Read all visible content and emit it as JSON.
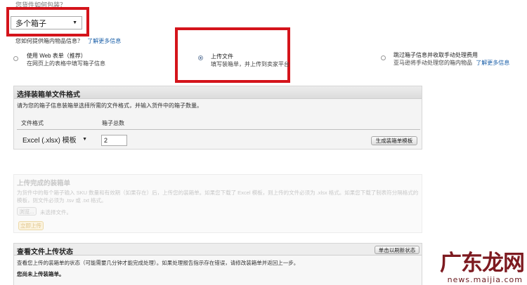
{
  "header": {
    "cut_label": "您货件如何包装？"
  },
  "packing": {
    "select_value": "多个箱子",
    "hint": "您如何提供箱内物品信息？",
    "hint_link": "了解更多信息"
  },
  "options": [
    {
      "title": "使用 Web 表单（推荐）",
      "sub": "在网页上的表格中填写箱子信息",
      "selected": false
    },
    {
      "title": "上传文件",
      "sub": "填写装箱单，并上传到卖家平台",
      "selected": true
    },
    {
      "title": "跳过箱子信息并收取手动处理费用",
      "sub": "亚马逊将手动处理您的箱内物品",
      "link": "了解更多信息",
      "selected": false
    }
  ],
  "format_panel": {
    "title": "选择装箱单文件格式",
    "desc": "请为您的箱子信息装箱单选择所需的文件格式，并输入货件中的箱子数量。",
    "col_format": "文件格式",
    "col_boxes": "箱子总数",
    "format_value": "Excel (.xlsx) 模板",
    "boxes_value": "2",
    "generate_button": "生成装箱单模板"
  },
  "upload_panel": {
    "title": "上传完成的装箱单",
    "desc": "为货件中的每个箱子输入 SKU 数量和有效期（如果存在）后，上传您的装箱单。如果您下载了 Excel 模板，则上传的文件必须为 .xlsx 格式。如果您下载了制表符分隔格式的模板，则文件必须为 .tsv 或 .txt 格式。",
    "browse_button": "浏览...",
    "no_file": "未选择文件。",
    "upload_button": "立即上传"
  },
  "status_panel": {
    "title": "查看文件上传状态",
    "refresh_button": "单击以刷新状态",
    "desc": "查看您上传的装箱单的状态（可能需要几分钟才能完成处理）。如果处理报告指示存在错误，请修改装箱单并返回上一步。",
    "empty": "您尚未上传装箱单。"
  },
  "watermark": {
    "main": "广东龙网",
    "sub": "news.maijia.com"
  },
  "colors": {
    "highlight": "#d4141b",
    "link": "#1a5fa8",
    "watermark": "#7d1a20"
  }
}
